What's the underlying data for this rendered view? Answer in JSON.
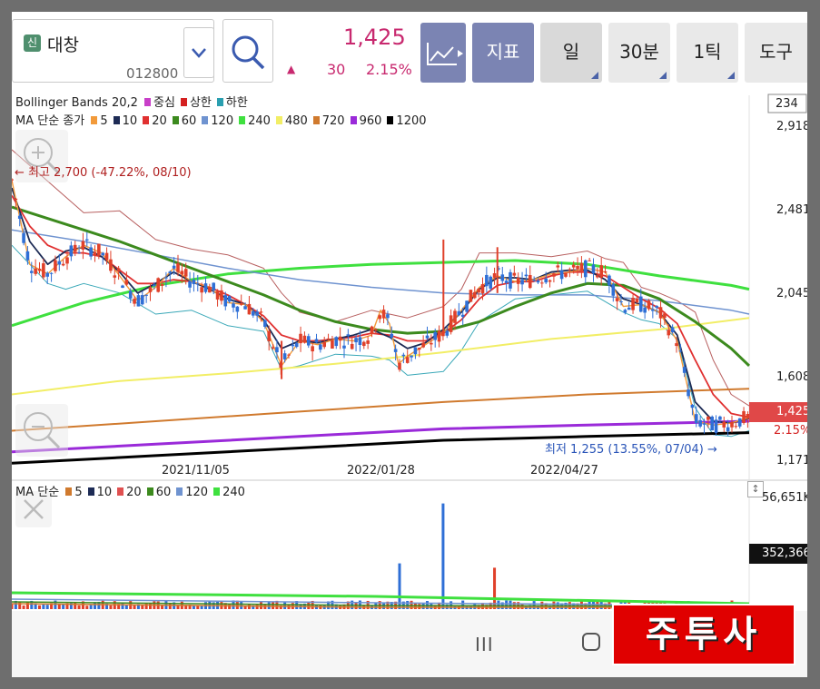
{
  "stock": {
    "badge": "신",
    "name": "대창",
    "code": "012800"
  },
  "quote": {
    "price": "1,425",
    "change_arrow": "▲",
    "change": "30",
    "change_pct": "2.15%"
  },
  "toolbar": {
    "indicator_label": "지표",
    "day_label": "일",
    "min30_label": "30분",
    "tick1_label": "1틱",
    "tools_label": "도구"
  },
  "legend_bb": {
    "prefix": "Bollinger Bands 20,2",
    "items": [
      {
        "label": "중심",
        "color": "#c83fc8"
      },
      {
        "label": "상한",
        "color": "#d42020"
      },
      {
        "label": "하한",
        "color": "#2a9fb0"
      }
    ]
  },
  "legend_ma": {
    "prefix": "MA 단순 종가",
    "items": [
      {
        "label": "5",
        "color": "#f29a3a"
      },
      {
        "label": "10",
        "color": "#1d2b55"
      },
      {
        "label": "20",
        "color": "#e03030"
      },
      {
        "label": "60",
        "color": "#3c8a1e"
      },
      {
        "label": "120",
        "color": "#6f93d0"
      },
      {
        "label": "240",
        "color": "#3fe03f"
      },
      {
        "label": "480",
        "color": "#f2ee66"
      },
      {
        "label": "720",
        "color": "#d07a2e"
      },
      {
        "label": "960",
        "color": "#9a2ad9"
      },
      {
        "label": "1200",
        "color": "#000000"
      }
    ]
  },
  "legend_vol": {
    "prefix": "MA 단순",
    "items": [
      {
        "label": "5",
        "color": "#d07a2e"
      },
      {
        "label": "10",
        "color": "#1d2b55"
      },
      {
        "label": "20",
        "color": "#e05050"
      },
      {
        "label": "60",
        "color": "#3c8a1e"
      },
      {
        "label": "120",
        "color": "#6f93d0"
      },
      {
        "label": "240",
        "color": "#3fe03f"
      }
    ]
  },
  "annotations": {
    "high": "← 최고 2,700 (-47.22%, 08/10)",
    "low": "최저 1,255 (13.55%, 07/04) →"
  },
  "axis": {
    "y_labels": [
      "234",
      "2,918",
      "2,481",
      "2,045",
      "1,608",
      "1,171"
    ],
    "price_tag": "1,425",
    "pct_tag": "2.15%",
    "x_labels": [
      "2021/11/05",
      "2022/01/28",
      "2022/04/27"
    ],
    "vol_labels": [
      "56,651K",
      "352,366"
    ]
  },
  "navbar": {
    "recent": "III"
  },
  "watermark": "주투사",
  "chart_data": {
    "type": "line",
    "y_range": [
      1171,
      2918
    ],
    "current_price": 1425,
    "series": [
      {
        "name": "5",
        "color": "#f29a3a",
        "points": [
          [
            0,
            2640
          ],
          [
            10,
            2200
          ],
          [
            20,
            2150
          ],
          [
            30,
            2240
          ],
          [
            40,
            2300
          ],
          [
            50,
            2260
          ],
          [
            60,
            2140
          ],
          [
            70,
            2010
          ],
          [
            80,
            2080
          ],
          [
            90,
            2180
          ],
          [
            100,
            2110
          ],
          [
            110,
            2080
          ],
          [
            120,
            2000
          ],
          [
            130,
            1990
          ],
          [
            140,
            1900
          ],
          [
            150,
            1670
          ],
          [
            160,
            1800
          ],
          [
            170,
            1780
          ],
          [
            180,
            1810
          ],
          [
            190,
            1800
          ],
          [
            200,
            1830
          ],
          [
            205,
            1960
          ],
          [
            210,
            1890
          ],
          [
            215,
            1680
          ],
          [
            220,
            1720
          ],
          [
            230,
            1780
          ],
          [
            240,
            1840
          ],
          [
            250,
            1960
          ],
          [
            260,
            2080
          ],
          [
            270,
            2140
          ],
          [
            280,
            2110
          ],
          [
            290,
            2120
          ],
          [
            300,
            2150
          ],
          [
            310,
            2160
          ],
          [
            320,
            2180
          ],
          [
            330,
            2160
          ],
          [
            340,
            1980
          ],
          [
            350,
            1990
          ],
          [
            360,
            1950
          ],
          [
            370,
            1800
          ],
          [
            380,
            1380
          ],
          [
            390,
            1360
          ],
          [
            400,
            1370
          ],
          [
            410,
            1400
          ]
        ]
      },
      {
        "name": "10",
        "color": "#1d2b55",
        "points": [
          [
            0,
            2600
          ],
          [
            10,
            2320
          ],
          [
            20,
            2200
          ],
          [
            30,
            2270
          ],
          [
            40,
            2290
          ],
          [
            50,
            2240
          ],
          [
            60,
            2160
          ],
          [
            70,
            2050
          ],
          [
            80,
            2100
          ],
          [
            90,
            2160
          ],
          [
            100,
            2110
          ],
          [
            110,
            2070
          ],
          [
            120,
            2020
          ],
          [
            130,
            1990
          ],
          [
            140,
            1910
          ],
          [
            150,
            1760
          ],
          [
            160,
            1800
          ],
          [
            170,
            1790
          ],
          [
            180,
            1810
          ],
          [
            190,
            1830
          ],
          [
            200,
            1860
          ],
          [
            210,
            1820
          ],
          [
            220,
            1760
          ],
          [
            230,
            1790
          ],
          [
            240,
            1860
          ],
          [
            250,
            1950
          ],
          [
            260,
            2070
          ],
          [
            270,
            2130
          ],
          [
            280,
            2130
          ],
          [
            290,
            2120
          ],
          [
            300,
            2160
          ],
          [
            310,
            2170
          ],
          [
            320,
            2170
          ],
          [
            330,
            2120
          ],
          [
            340,
            2020
          ],
          [
            350,
            1990
          ],
          [
            360,
            1950
          ],
          [
            370,
            1830
          ],
          [
            380,
            1480
          ],
          [
            390,
            1380
          ],
          [
            400,
            1370
          ],
          [
            410,
            1395
          ]
        ]
      },
      {
        "name": "20",
        "color": "#e03030",
        "points": [
          [
            0,
            2560
          ],
          [
            10,
            2400
          ],
          [
            20,
            2300
          ],
          [
            30,
            2260
          ],
          [
            40,
            2260
          ],
          [
            50,
            2240
          ],
          [
            60,
            2170
          ],
          [
            70,
            2100
          ],
          [
            80,
            2100
          ],
          [
            90,
            2120
          ],
          [
            100,
            2110
          ],
          [
            110,
            2080
          ],
          [
            120,
            2040
          ],
          [
            130,
            1990
          ],
          [
            140,
            1930
          ],
          [
            150,
            1830
          ],
          [
            160,
            1800
          ],
          [
            170,
            1800
          ],
          [
            180,
            1810
          ],
          [
            190,
            1820
          ],
          [
            200,
            1840
          ],
          [
            210,
            1830
          ],
          [
            220,
            1800
          ],
          [
            230,
            1800
          ],
          [
            240,
            1840
          ],
          [
            250,
            1910
          ],
          [
            260,
            2020
          ],
          [
            270,
            2090
          ],
          [
            280,
            2110
          ],
          [
            290,
            2110
          ],
          [
            300,
            2140
          ],
          [
            310,
            2160
          ],
          [
            320,
            2160
          ],
          [
            330,
            2140
          ],
          [
            340,
            2080
          ],
          [
            350,
            2020
          ],
          [
            360,
            1970
          ],
          [
            370,
            1890
          ],
          [
            380,
            1700
          ],
          [
            390,
            1520
          ],
          [
            400,
            1420
          ],
          [
            410,
            1400
          ]
        ]
      },
      {
        "name": "60",
        "color": "#3c8a1e",
        "points": [
          [
            0,
            2500
          ],
          [
            20,
            2440
          ],
          [
            40,
            2380
          ],
          [
            60,
            2320
          ],
          [
            80,
            2250
          ],
          [
            100,
            2180
          ],
          [
            120,
            2110
          ],
          [
            140,
            2040
          ],
          [
            160,
            1960
          ],
          [
            180,
            1900
          ],
          [
            200,
            1860
          ],
          [
            210,
            1850
          ],
          [
            220,
            1840
          ],
          [
            240,
            1850
          ],
          [
            260,
            1900
          ],
          [
            280,
            1980
          ],
          [
            300,
            2050
          ],
          [
            320,
            2100
          ],
          [
            340,
            2090
          ],
          [
            360,
            2020
          ],
          [
            380,
            1900
          ],
          [
            400,
            1760
          ],
          [
            410,
            1670
          ]
        ]
      },
      {
        "name": "120",
        "color": "#6f93d0",
        "points": [
          [
            0,
            2380
          ],
          [
            40,
            2320
          ],
          [
            80,
            2250
          ],
          [
            120,
            2180
          ],
          [
            160,
            2120
          ],
          [
            200,
            2080
          ],
          [
            240,
            2050
          ],
          [
            280,
            2040
          ],
          [
            320,
            2040
          ],
          [
            360,
            2010
          ],
          [
            400,
            1960
          ],
          [
            410,
            1940
          ]
        ]
      },
      {
        "name": "240",
        "color": "#3fe03f",
        "points": [
          [
            0,
            1880
          ],
          [
            40,
            2000
          ],
          [
            80,
            2090
          ],
          [
            120,
            2150
          ],
          [
            160,
            2180
          ],
          [
            200,
            2200
          ],
          [
            240,
            2210
          ],
          [
            280,
            2220
          ],
          [
            320,
            2200
          ],
          [
            360,
            2140
          ],
          [
            400,
            2090
          ],
          [
            410,
            2070
          ]
        ]
      },
      {
        "name": "480",
        "color": "#f2ee66",
        "points": [
          [
            0,
            1520
          ],
          [
            60,
            1590
          ],
          [
            120,
            1630
          ],
          [
            180,
            1680
          ],
          [
            240,
            1740
          ],
          [
            300,
            1810
          ],
          [
            360,
            1860
          ],
          [
            410,
            1920
          ]
        ]
      },
      {
        "name": "720",
        "color": "#d07a2e",
        "points": [
          [
            0,
            1330
          ],
          [
            80,
            1380
          ],
          [
            160,
            1430
          ],
          [
            240,
            1480
          ],
          [
            320,
            1520
          ],
          [
            410,
            1550
          ]
        ]
      },
      {
        "name": "960",
        "color": "#9a2ad9",
        "points": [
          [
            0,
            1220
          ],
          [
            80,
            1260
          ],
          [
            160,
            1300
          ],
          [
            240,
            1340
          ],
          [
            320,
            1360
          ],
          [
            410,
            1380
          ]
        ]
      },
      {
        "name": "1200",
        "color": "#000000",
        "points": [
          [
            0,
            1160
          ],
          [
            80,
            1200
          ],
          [
            160,
            1240
          ],
          [
            240,
            1280
          ],
          [
            320,
            1300
          ],
          [
            410,
            1320
          ]
        ]
      }
    ],
    "bollinger": {
      "upper": [
        [
          0,
          2800
        ],
        [
          40,
          2470
        ],
        [
          60,
          2480
        ],
        [
          80,
          2330
        ],
        [
          100,
          2280
        ],
        [
          120,
          2250
        ],
        [
          140,
          2180
        ],
        [
          150,
          2050
        ],
        [
          160,
          1950
        ],
        [
          180,
          1900
        ],
        [
          200,
          1960
        ],
        [
          220,
          1920
        ],
        [
          240,
          1980
        ],
        [
          250,
          2070
        ],
        [
          260,
          2260
        ],
        [
          280,
          2260
        ],
        [
          300,
          2240
        ],
        [
          320,
          2270
        ],
        [
          330,
          2230
        ],
        [
          340,
          2210
        ],
        [
          350,
          2080
        ],
        [
          360,
          2050
        ],
        [
          370,
          2010
        ],
        [
          380,
          1950
        ],
        [
          390,
          1700
        ],
        [
          400,
          1520
        ],
        [
          410,
          1460
        ]
      ],
      "lower": [
        [
          0,
          2300
        ],
        [
          10,
          2200
        ],
        [
          20,
          2100
        ],
        [
          30,
          2070
        ],
        [
          40,
          2100
        ],
        [
          60,
          2050
        ],
        [
          80,
          1940
        ],
        [
          100,
          1960
        ],
        [
          120,
          1880
        ],
        [
          140,
          1850
        ],
        [
          150,
          1650
        ],
        [
          160,
          1670
        ],
        [
          180,
          1730
        ],
        [
          200,
          1720
        ],
        [
          210,
          1700
        ],
        [
          220,
          1620
        ],
        [
          240,
          1640
        ],
        [
          250,
          1750
        ],
        [
          260,
          1900
        ],
        [
          280,
          2020
        ],
        [
          300,
          2040
        ],
        [
          320,
          2060
        ],
        [
          340,
          1950
        ],
        [
          350,
          1910
        ],
        [
          360,
          1890
        ],
        [
          370,
          1810
        ],
        [
          380,
          1450
        ],
        [
          390,
          1310
        ],
        [
          400,
          1300
        ],
        [
          410,
          1330
        ]
      ]
    }
  }
}
